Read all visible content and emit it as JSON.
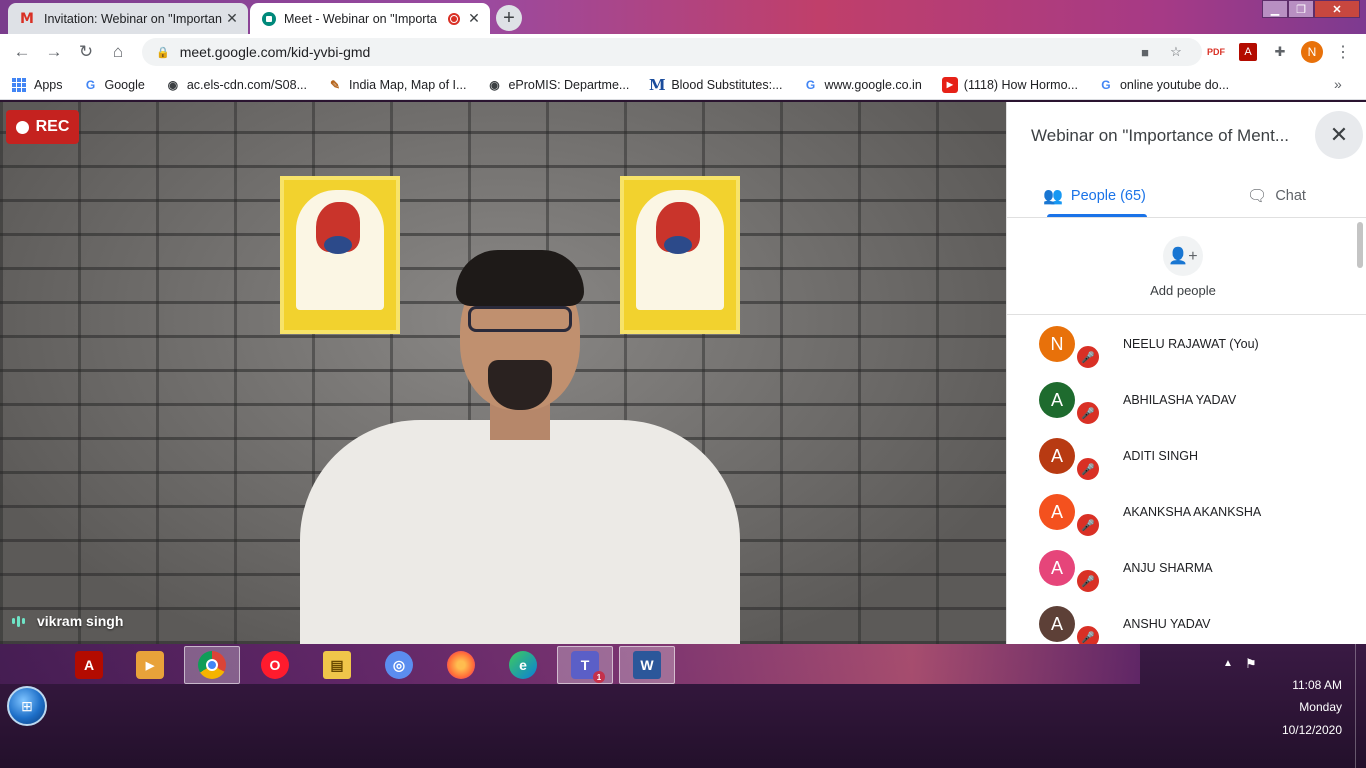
{
  "browser": {
    "tabs": [
      {
        "title": "Invitation: Webinar on \"Importan",
        "icon": "gmail-icon"
      },
      {
        "title": "Meet - Webinar on \"Importa",
        "icon": "meet-icon",
        "recording": true
      }
    ],
    "url": "meet.google.com/kid-yvbi-gmd",
    "profile_initial": "N",
    "bookmarks": [
      {
        "label": "Apps",
        "icon": "apps-grid-icon"
      },
      {
        "label": "Google",
        "icon": "google-icon"
      },
      {
        "label": "ac.els-cdn.com/S08...",
        "icon": "globe-icon"
      },
      {
        "label": "India Map, Map of I...",
        "icon": "map-icon"
      },
      {
        "label": "eProMIS: Departme...",
        "icon": "globe-icon"
      },
      {
        "label": "Blood Substitutes:...",
        "icon": "m-icon"
      },
      {
        "label": "www.google.co.in",
        "icon": "google-icon"
      },
      {
        "label": "(1118) How Hormo...",
        "icon": "youtube-icon"
      },
      {
        "label": "online youtube do...",
        "icon": "google-icon"
      }
    ]
  },
  "meet": {
    "rec_label": "REC",
    "speaker_name": "vikram singh",
    "panel": {
      "title": "Webinar on \"Importance of Ment...",
      "people_tab": "People (65)",
      "chat_tab": "Chat",
      "add_people": "Add people",
      "participants": [
        {
          "initial": "N",
          "name": "NEELU RAJAWAT (You)",
          "color": "#e8710a"
        },
        {
          "initial": "A",
          "name": "ABHILASHA YADAV",
          "color": "#1e6b2e"
        },
        {
          "initial": "A",
          "name": "ADITI SINGH",
          "color": "#b83a12"
        },
        {
          "initial": "A",
          "name": "AKANKSHA AKANKSHA",
          "color": "#f4511e"
        },
        {
          "initial": "A",
          "name": "ANJU SHARMA",
          "color": "#e6457a"
        },
        {
          "initial": "A",
          "name": "ANSHU YADAV",
          "color": "#5d4037"
        }
      ]
    }
  },
  "taskbar": {
    "apps": [
      {
        "name": "acrobat-reader-icon",
        "open": false
      },
      {
        "name": "media-player-icon",
        "open": false
      },
      {
        "name": "chrome-icon",
        "open": true
      },
      {
        "name": "opera-icon",
        "open": false
      },
      {
        "name": "file-explorer-icon",
        "open": false
      },
      {
        "name": "chromium-icon",
        "open": false
      },
      {
        "name": "firefox-icon",
        "open": false
      },
      {
        "name": "edge-icon",
        "open": false
      },
      {
        "name": "teams-icon",
        "open": true,
        "badge": "1"
      },
      {
        "name": "word-icon",
        "open": true
      }
    ],
    "time": "11:08 AM",
    "day": "Monday",
    "date": "10/12/2020"
  },
  "colors": {
    "accent": "#1a73e8",
    "rec": "#c5221f",
    "mic_muted": "#d93025"
  }
}
